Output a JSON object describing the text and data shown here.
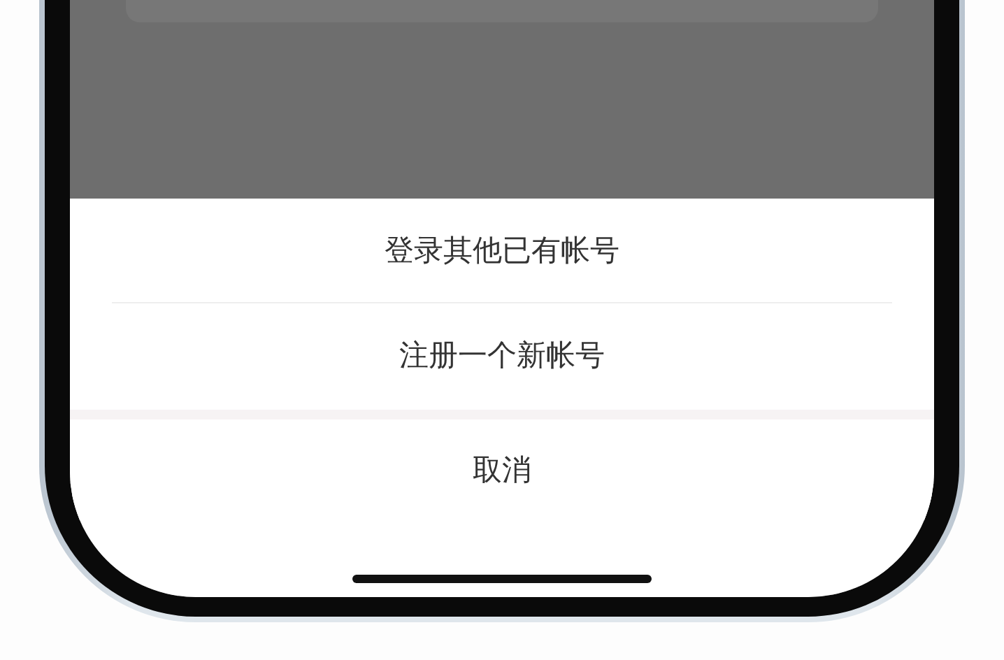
{
  "action_sheet": {
    "options": [
      {
        "label": "登录其他已有帐号"
      },
      {
        "label": "注册一个新帐号"
      }
    ],
    "cancel": "取消"
  }
}
